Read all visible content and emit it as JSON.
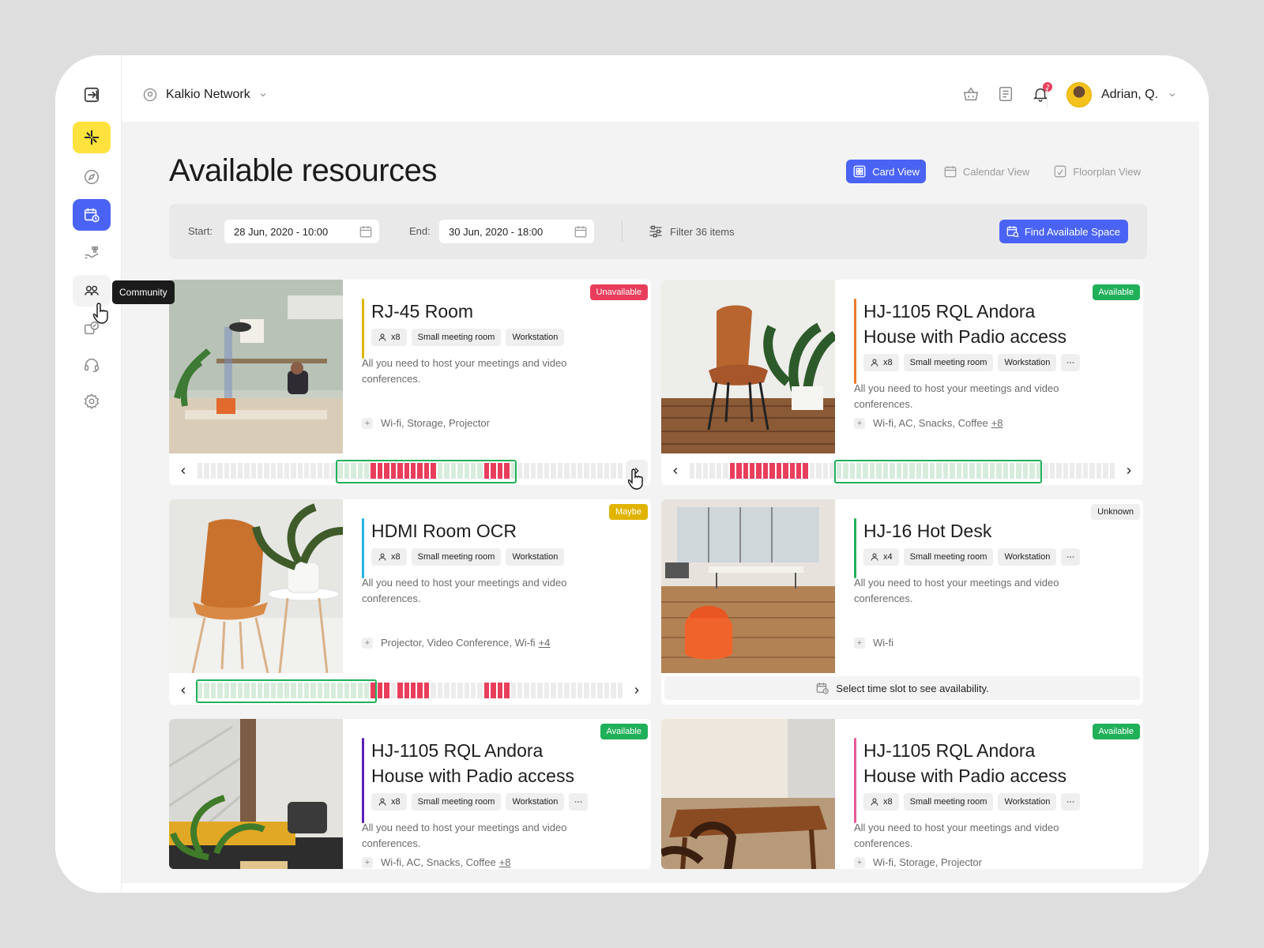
{
  "topbar": {
    "network": "Kalkio Network",
    "user_name": "Adrian, Q.",
    "notification_count": "2"
  },
  "sidebar": {
    "items": [
      {
        "name": "collapse"
      },
      {
        "name": "logo"
      },
      {
        "name": "explore"
      },
      {
        "name": "bookings"
      },
      {
        "name": "services"
      },
      {
        "name": "community"
      },
      {
        "name": "offers"
      },
      {
        "name": "support"
      },
      {
        "name": "settings"
      }
    ],
    "tooltip": "Community"
  },
  "page": {
    "title": "Available resources"
  },
  "views": {
    "card": "Card View",
    "calendar": "Calendar View",
    "floorplan": "Floorplan View"
  },
  "filters": {
    "start_label": "Start:",
    "start_value": "28 Jun, 2020 - 10:00",
    "end_label": "End:",
    "end_value": "30 Jun, 2020 - 18:00",
    "filter_label": "Filter 36 items",
    "find_button": "Find Available Space"
  },
  "colors": {
    "primary": "#4a63f5",
    "available": "#21b05a",
    "unavailable": "#e83e5c",
    "maybe": "#e0b400",
    "unknown": "#efefef"
  },
  "cards": [
    {
      "title": "RJ-45 Room",
      "status": "Unavailable",
      "status_color": "#e83e5c",
      "accent": "#e0b400",
      "capacity": "x8",
      "tag1": "Small meeting room",
      "tag2": "Workstation",
      "has_more": false,
      "desc": "All you need to host your meetings and video conferences.",
      "amenities": "Wi-fi, Storage, Projector",
      "amenities_more": "",
      "photo": "office",
      "timeline": true,
      "slot_hint": ""
    },
    {
      "title": "HJ-1105 RQL Andora House with Padio access",
      "status": "Available",
      "status_color": "#21b05a",
      "accent": "#f07a2a",
      "capacity": "x8",
      "tag1": "Small meeting room",
      "tag2": "Workstation",
      "has_more": true,
      "desc": "All you need to host your meetings and video conferences.",
      "amenities": "Wi-fi, AC, Snacks, Coffee",
      "amenities_more": "+8",
      "photo": "chair-wood",
      "timeline": true,
      "slot_hint": ""
    },
    {
      "title": "HDMI Room OCR",
      "status": "Maybe",
      "status_color": "#e0b400",
      "accent": "#26b4e8",
      "capacity": "x8",
      "tag1": "Small meeting room",
      "tag2": "Workstation",
      "has_more": false,
      "desc": "All you need to host your meetings and video conferences.",
      "amenities": "Projector, Video Conference, Wi-fi",
      "amenities_more": "+4",
      "photo": "chair-white",
      "timeline": true,
      "slot_hint": ""
    },
    {
      "title": "HJ-16 Hot Desk",
      "status": "Unknown",
      "status_color": "#efefef",
      "accent": "#21b05a",
      "capacity": "x4",
      "tag1": "Small meeting room",
      "tag2": "Workstation",
      "has_more": true,
      "desc": "All you need to host your meetings and video conferences.",
      "amenities": "Wi-fi",
      "amenities_more": "",
      "photo": "cafe",
      "timeline": false,
      "slot_hint": "Select time slot to see availability."
    },
    {
      "title": "HJ-1105 RQL Andora House with Padio access",
      "status": "Available",
      "status_color": "#21b05a",
      "accent": "#5b1fb8",
      "capacity": "x8",
      "tag1": "Small meeting room",
      "tag2": "Workstation",
      "has_more": true,
      "desc": "All you need to host your meetings and video conferences.",
      "amenities": "Wi-fi, AC, Snacks, Coffee",
      "amenities_more": "+8",
      "photo": "lounge",
      "timeline": false,
      "slot_hint": ""
    },
    {
      "title": "HJ-1105 RQL Andora House with Padio access",
      "status": "Available",
      "status_color": "#21b05a",
      "accent": "#e85a9a",
      "capacity": "x8",
      "tag1": "Small meeting room",
      "tag2": "Workstation",
      "has_more": true,
      "desc": "All you need to host your meetings and video conferences.",
      "amenities": "Wi-fi, Storage, Projector",
      "amenities_more": "",
      "photo": "table",
      "timeline": false,
      "slot_hint": ""
    }
  ]
}
